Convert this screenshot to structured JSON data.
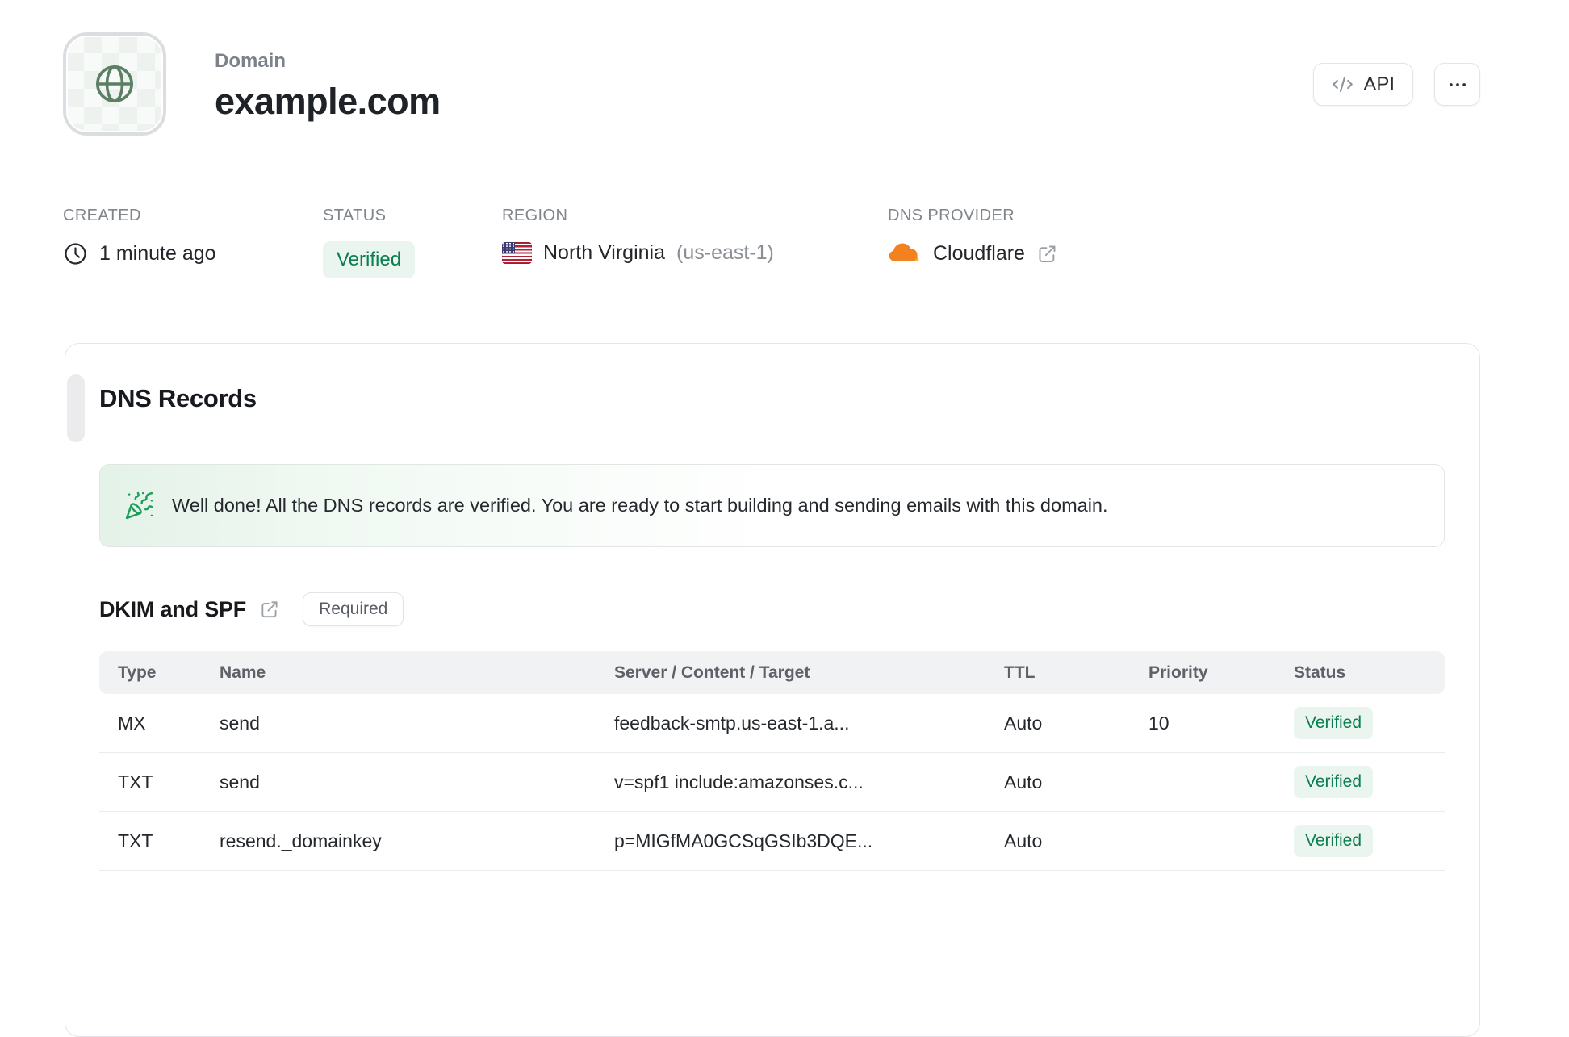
{
  "header": {
    "kicker": "Domain",
    "title": "example.com",
    "api_button_label": "API"
  },
  "meta": {
    "created": {
      "label": "CREATED",
      "value": "1 minute ago"
    },
    "status": {
      "label": "STATUS",
      "value": "Verified"
    },
    "region": {
      "label": "REGION",
      "value": "North Virginia",
      "code": "(us-east-1)"
    },
    "dns_provider": {
      "label": "DNS PROVIDER",
      "value": "Cloudflare"
    }
  },
  "card": {
    "title": "DNS Records",
    "banner": {
      "text": "Well done! All the DNS records are verified. You are ready to start building and sending emails with this domain."
    },
    "section": {
      "title": "DKIM and SPF",
      "badge": "Required"
    },
    "table": {
      "headers": [
        "Type",
        "Name",
        "Server / Content / Target",
        "TTL",
        "Priority",
        "Status"
      ],
      "rows": [
        {
          "type": "MX",
          "name": "send",
          "content": "feedback-smtp.us-east-1.a...",
          "ttl": "Auto",
          "priority": "10",
          "status": "Verified"
        },
        {
          "type": "TXT",
          "name": "send",
          "content": "v=spf1 include:amazonses.c...",
          "ttl": "Auto",
          "priority": "",
          "status": "Verified"
        },
        {
          "type": "TXT",
          "name": "resend._domainkey",
          "content": "p=MIGfMA0GCSqGSIb3DQE...",
          "ttl": "Auto",
          "priority": "",
          "status": "Verified"
        }
      ]
    }
  },
  "icons": {
    "globe": "globe-icon",
    "code": "code-icon",
    "ellipsis": "ellipsis-icon",
    "clock": "clock-icon",
    "us_flag": "us-flag-icon",
    "cloudflare": "cloudflare-icon",
    "external_link": "external-link-icon",
    "party_popper": "party-popper-icon"
  },
  "colors": {
    "accent_green_text": "#0b7d50",
    "accent_green_bg": "#e9f5ee",
    "banner_green": "#e4f2e8",
    "globe_green": "#5a7f64",
    "cloudflare_orange": "#f48120",
    "cloudflare_orange_light": "#faad3f",
    "flag_red": "#b22234",
    "flag_blue": "#3c3b6e",
    "border": "#e3e5e8",
    "label_gray": "#80858c",
    "text_dark": "#24272c"
  }
}
